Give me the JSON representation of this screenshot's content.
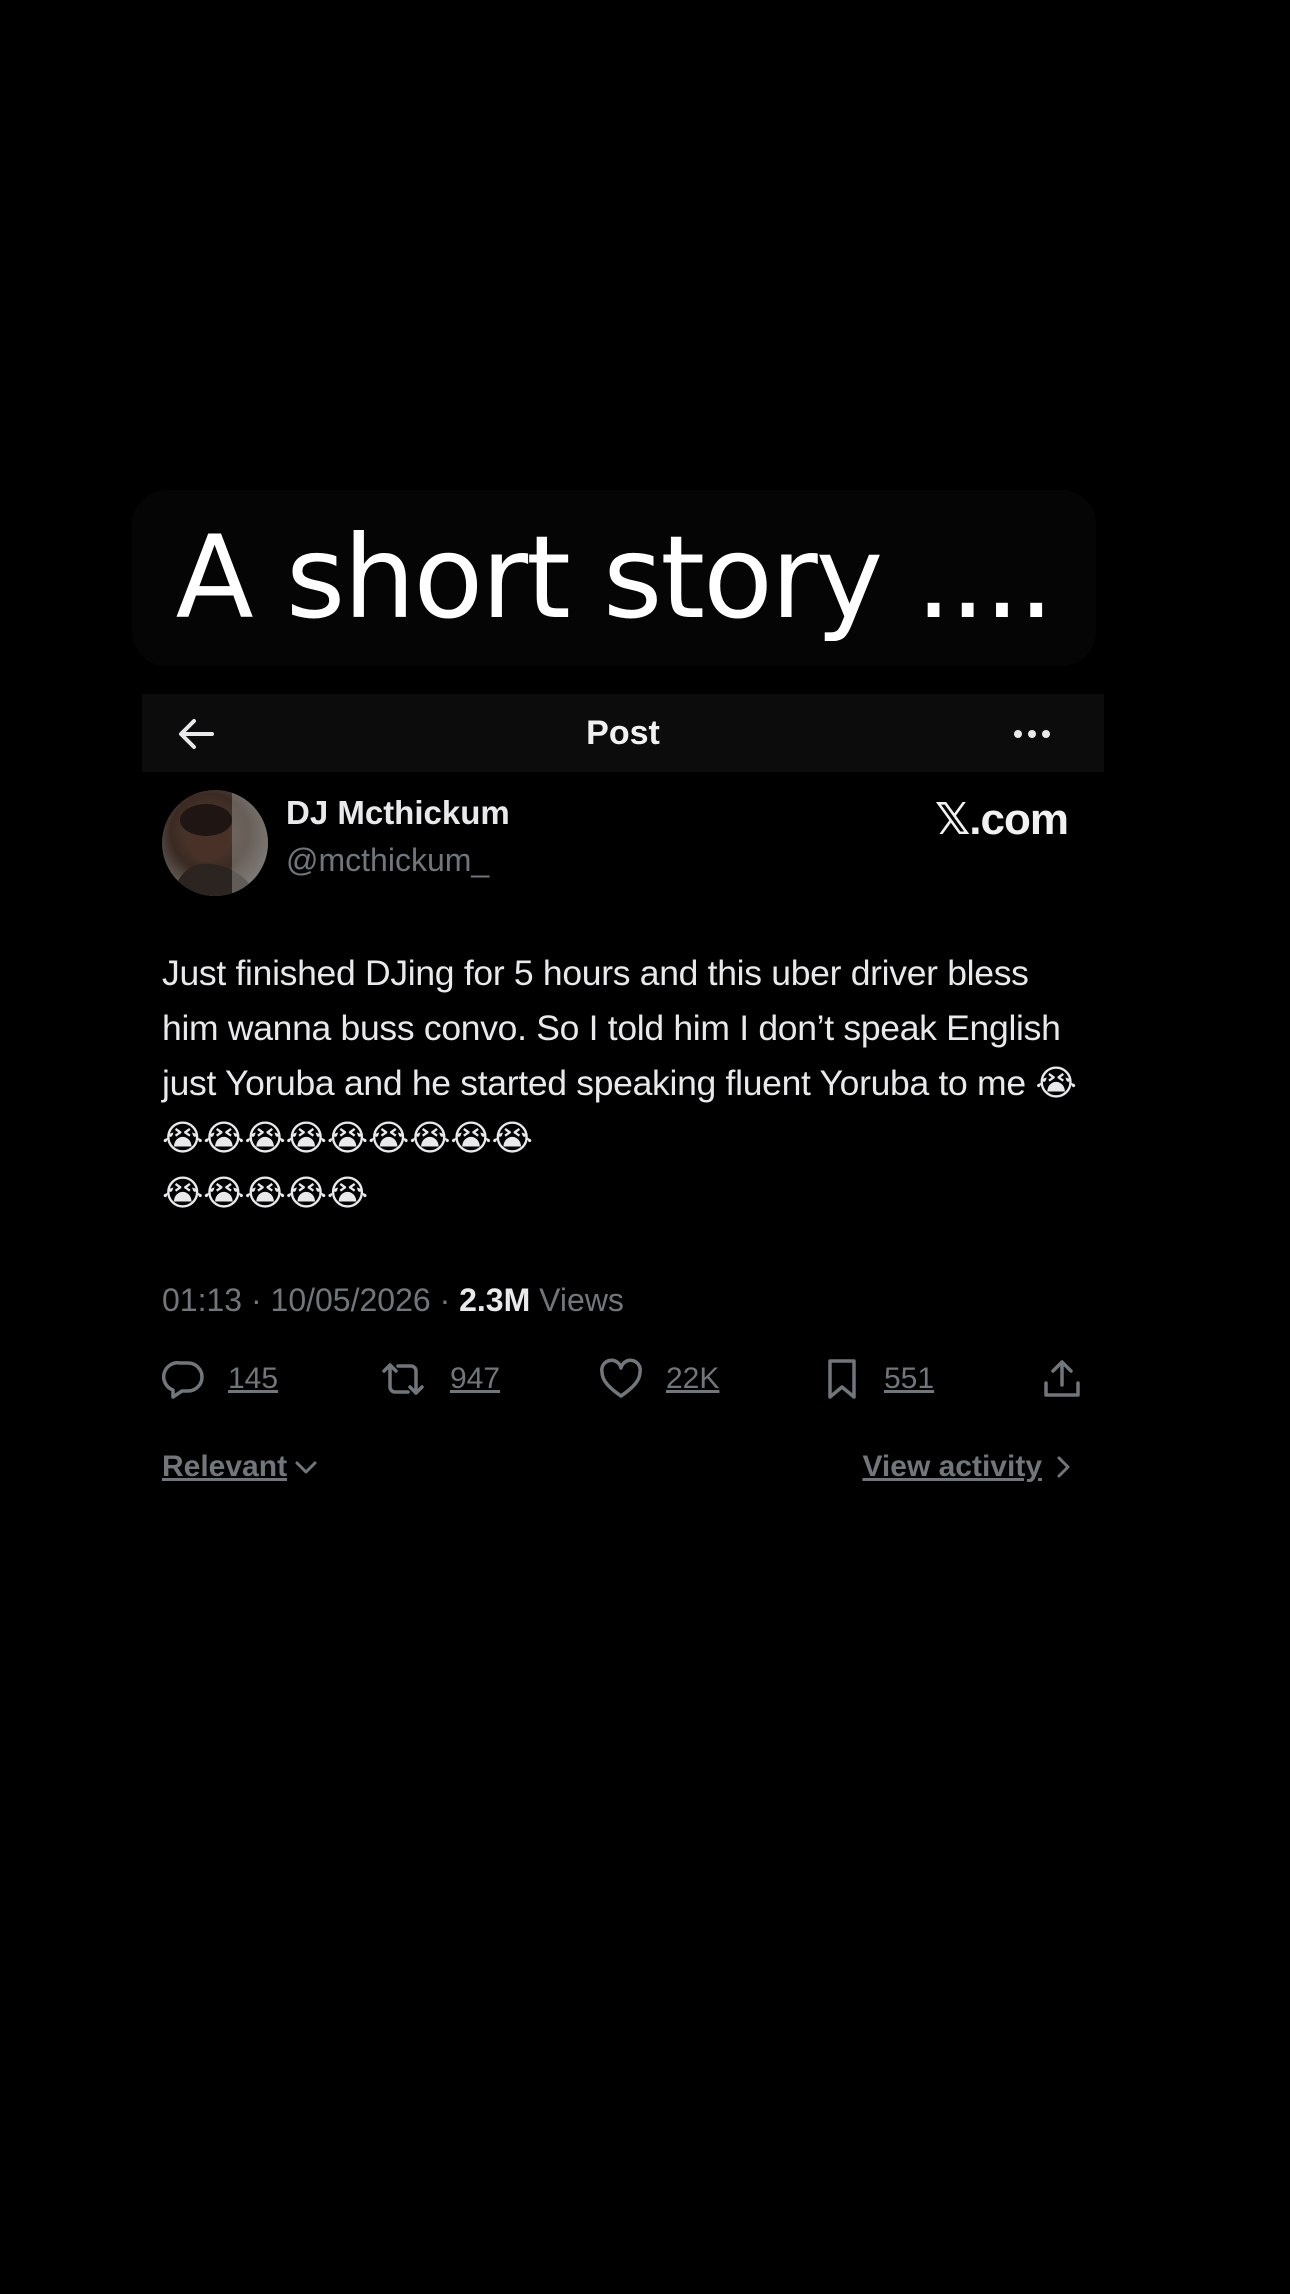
{
  "caption": {
    "text": "A short story ...."
  },
  "header": {
    "title": "Post"
  },
  "author": {
    "name": "DJ Mcthickum",
    "handle": "@mcthickum_"
  },
  "brand": "𝕏.com",
  "post": {
    "text": "Just finished DJing for 5 hours and this uber driver bless him wanna buss convo. So I told him I don’t speak English just Yoruba and he started speaking fluent Yoruba to me 😭😭😭😭😭😭😭😭😭😭\n😭😭😭😭😭"
  },
  "meta": {
    "time": "01:13",
    "separator": " · ",
    "date": "10/05/2026",
    "views_count": "2.3M",
    "views_label": " Views"
  },
  "actions": {
    "replies": "145",
    "reposts": "947",
    "likes": "22K",
    "bookmarks": "551"
  },
  "footer": {
    "relevant_label": "Relevant",
    "view_activity_label": "View activity"
  },
  "colors": {
    "background": "#000000",
    "text": "#e7e9ea",
    "muted": "#71767b"
  }
}
